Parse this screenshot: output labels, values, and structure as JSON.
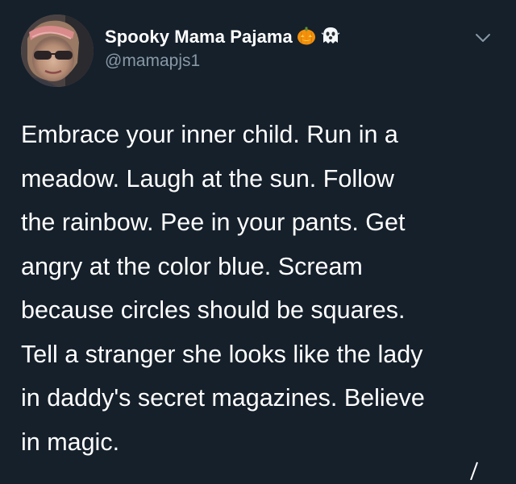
{
  "tweet": {
    "author": {
      "display_name": "Spooky Mama Pajama",
      "handle": "@mamapjs1",
      "name_emojis": [
        "pumpkin-icon",
        "ghost-icon"
      ]
    },
    "text": "Embrace your inner child. Run in a\nmeadow. Laugh at the sun. Follow\nthe rainbow. Pee in your pants. Get\nangry at the color blue. Scream\nbecause circles should be squares.\nTell a stranger she looks like the lady\nin daddy's secret magazines. Believe\nin magic."
  },
  "colors": {
    "background": "#15202b",
    "text": "#ffffff",
    "secondary": "#8899a6",
    "pumpkin": "#f4900c"
  }
}
